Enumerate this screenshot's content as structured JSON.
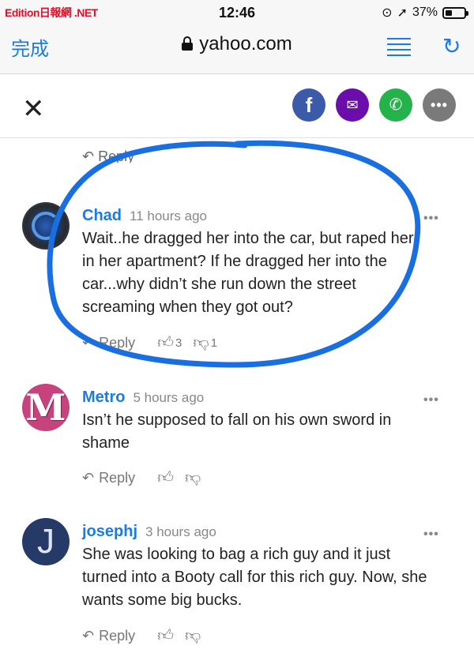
{
  "status_bar": {
    "carrier": "Edition日報網 .NET",
    "time": "12:46",
    "battery": "37%",
    "battery_level": 0.37
  },
  "browser": {
    "done_label": "完成",
    "address": "yahoo.com",
    "reader_icon": "reader-icon",
    "refresh_icon": "↻"
  },
  "share": {
    "close": "✕",
    "facebook": "f",
    "email": "✉",
    "whatsapp": "✆",
    "more": "•••"
  },
  "partial_reply": "↶ Reply",
  "comments": [
    {
      "name": "Chad",
      "time": "11 hours ago",
      "text": "Wait..he dragged her into the car, but raped her in her apartment? If he dragged her into the car...why didn’t she run down the street screaming when they got out?",
      "reply": "Reply",
      "likes": "3",
      "dislikes": "1"
    },
    {
      "name": "Metro",
      "time": "5 hours ago",
      "avatar_letter": "M",
      "text": "Isn’t he supposed to fall on his own sword in shame",
      "reply": "Reply",
      "likes": "",
      "dislikes": ""
    },
    {
      "name": "josephj",
      "time": "3 hours ago",
      "avatar_letter": "J",
      "text": "She was looking to bag a rich guy and it just turned into a Booty call for this rich guy. Now, she wants some big bucks.",
      "reply": "Reply",
      "likes": "",
      "dislikes": ""
    }
  ],
  "colors": {
    "link_blue": "#1a7be6",
    "annotation_blue": "#1a6fe0",
    "facebook": "#3b5aa8",
    "email": "#6a0dab",
    "whatsapp": "#25b24a"
  }
}
